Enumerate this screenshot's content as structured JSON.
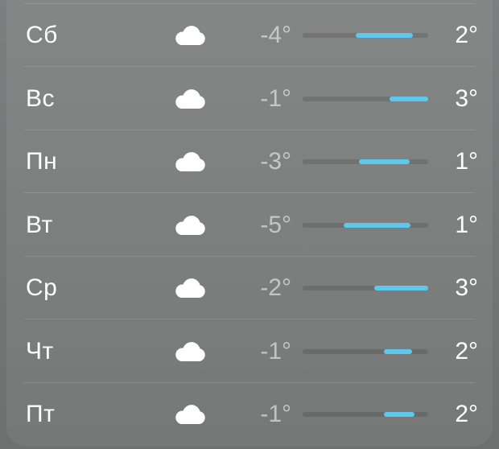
{
  "forecast": {
    "range_min": -5,
    "range_max": 3,
    "accent_color": "#5cc8ee",
    "days": [
      {
        "day": "Сб",
        "icon": "cloud-icon",
        "low_label": "-4°",
        "high_label": "2°",
        "bar_start": 0.42,
        "bar_end": 0.88
      },
      {
        "day": "Вс",
        "icon": "cloud-icon",
        "low_label": "-1°",
        "high_label": "3°",
        "bar_start": 0.69,
        "bar_end": 1.0
      },
      {
        "day": "Пн",
        "icon": "cloud-icon",
        "low_label": "-3°",
        "high_label": "1°",
        "bar_start": 0.45,
        "bar_end": 0.85
      },
      {
        "day": "Вт",
        "icon": "cloud-icon",
        "low_label": "-5°",
        "high_label": "1°",
        "bar_start": 0.33,
        "bar_end": 0.86
      },
      {
        "day": "Ср",
        "icon": "cloud-icon",
        "low_label": "-2°",
        "high_label": "3°",
        "bar_start": 0.57,
        "bar_end": 1.0
      },
      {
        "day": "Чт",
        "icon": "cloud-icon",
        "low_label": "-1°",
        "high_label": "2°",
        "bar_start": 0.65,
        "bar_end": 0.87
      },
      {
        "day": "Пт",
        "icon": "cloud-icon",
        "low_label": "-1°",
        "high_label": "2°",
        "bar_start": 0.65,
        "bar_end": 0.89
      }
    ]
  }
}
